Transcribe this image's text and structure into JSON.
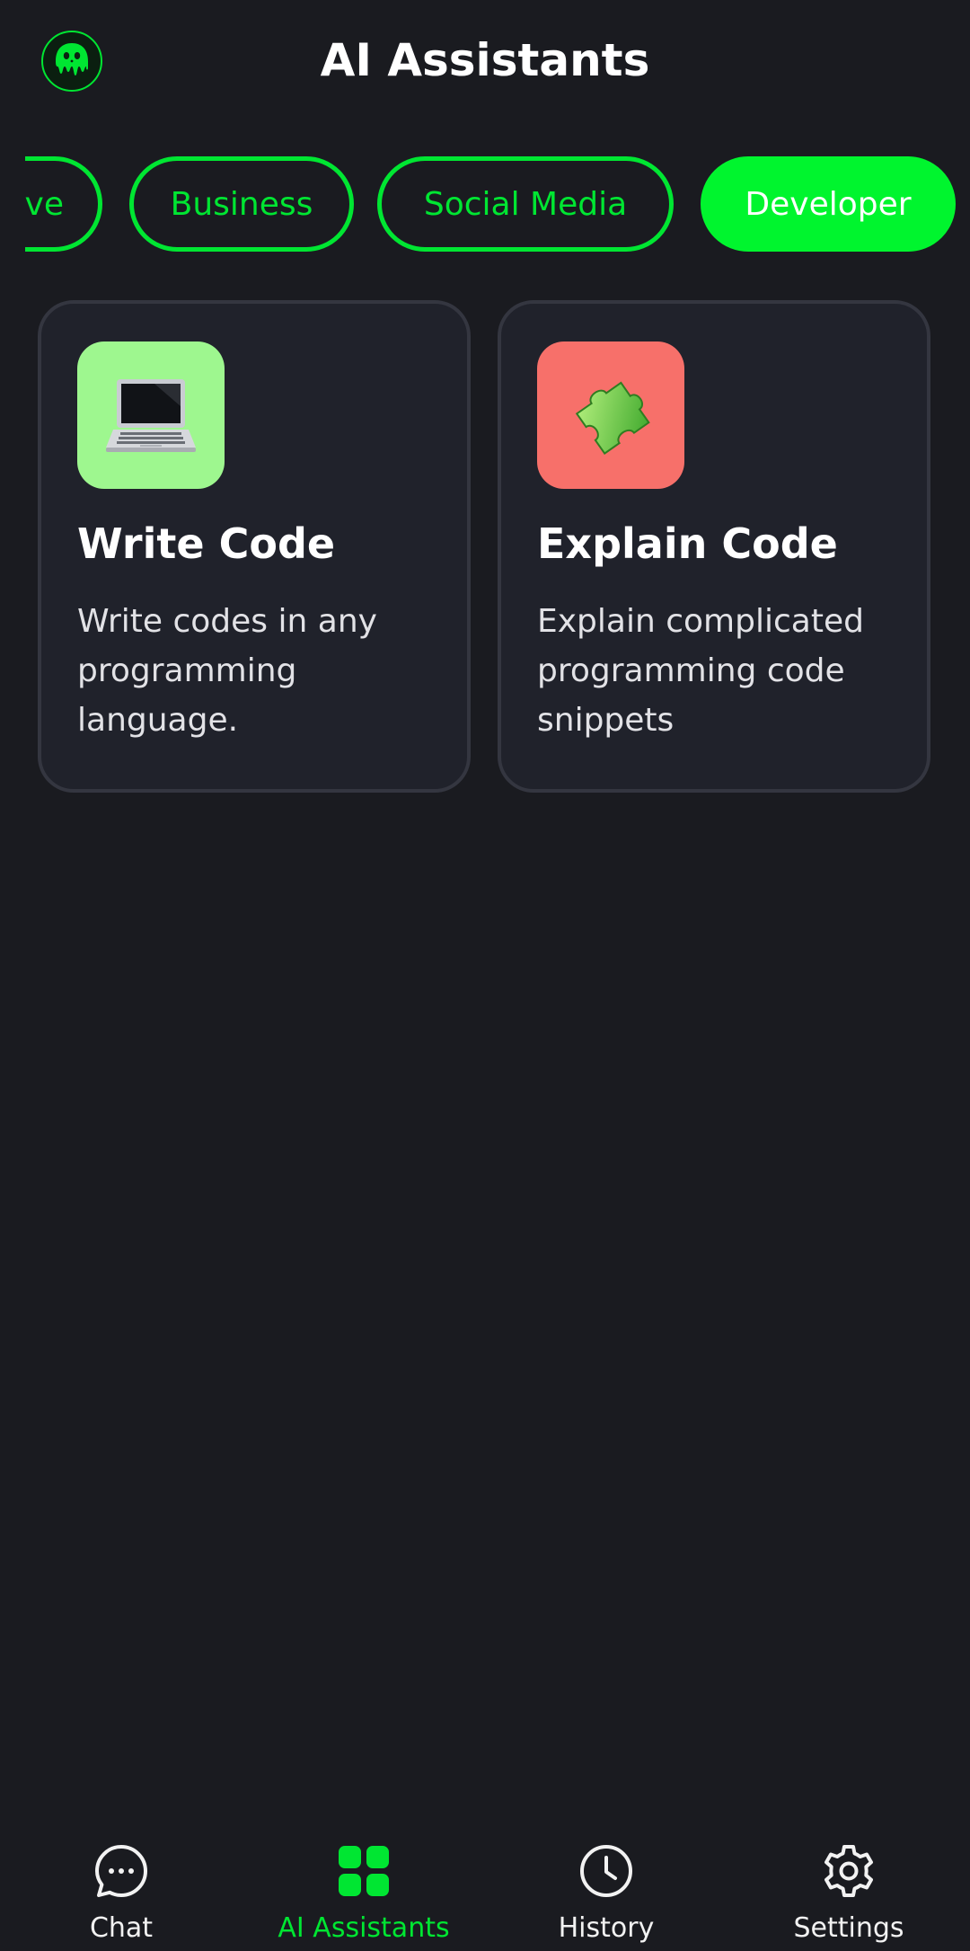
{
  "header": {
    "title": "AI Assistants",
    "logo_icon": "slime-mascot-icon"
  },
  "category_tabs": [
    {
      "label": "ve"
    },
    {
      "label": "Business"
    },
    {
      "label": "Social Media"
    },
    {
      "label": "Developer",
      "active": true
    }
  ],
  "cards": [
    {
      "title": "Write Code",
      "description": "Write codes in any programming language.",
      "icon": "laptop-icon",
      "icon_bg": "#9ef78f"
    },
    {
      "title": "Explain Code",
      "description": "Explain complicated programming code snippets",
      "icon": "puzzle-piece-icon",
      "icon_bg": "#f7706a"
    }
  ],
  "bottom_nav": [
    {
      "label": "Chat",
      "icon": "chat-bubble-icon"
    },
    {
      "label": "AI Assistants",
      "icon": "grid-icon",
      "active": true
    },
    {
      "label": "History",
      "icon": "clock-icon"
    },
    {
      "label": "Settings",
      "icon": "gear-icon"
    }
  ],
  "colors": {
    "accent": "#00e632",
    "background": "#1a1b20",
    "card": "#20222b"
  }
}
